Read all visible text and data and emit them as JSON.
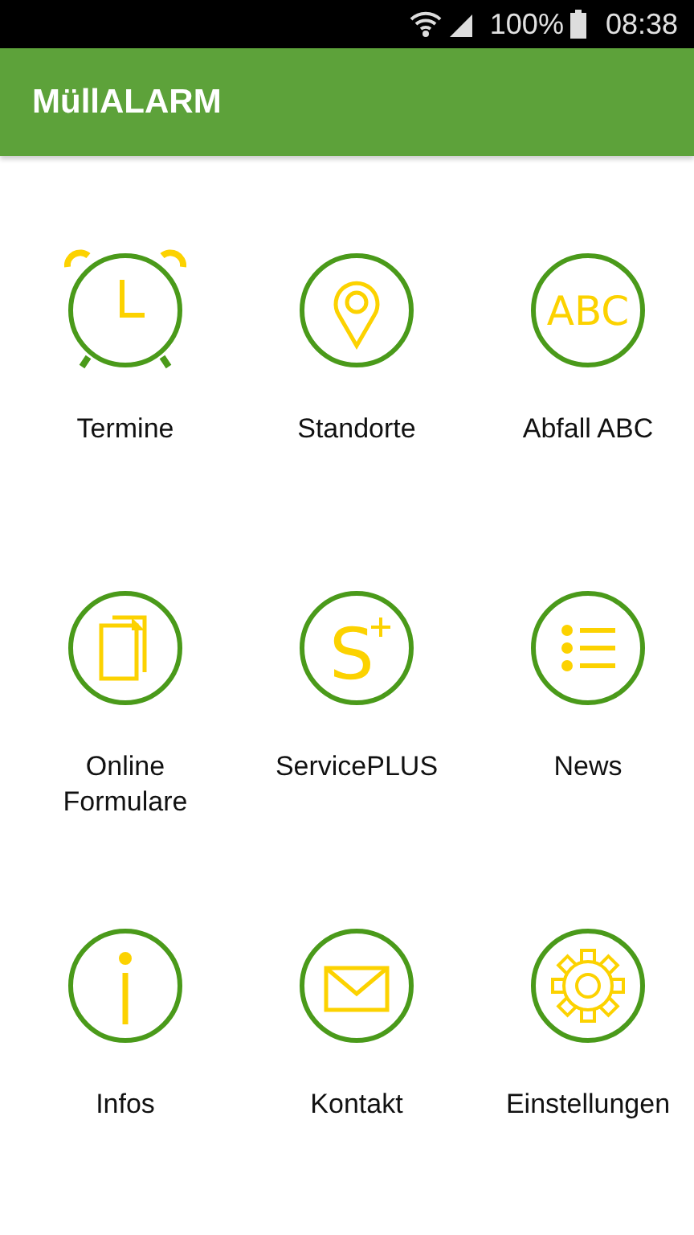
{
  "status_bar": {
    "battery": "100%",
    "time": "08:38"
  },
  "app_bar": {
    "title": "MüllALARM"
  },
  "tiles": [
    {
      "label": "Termine"
    },
    {
      "label": "Standorte"
    },
    {
      "label": "Abfall ABC",
      "icon_text": "ABC"
    },
    {
      "label": "Online Formulare"
    },
    {
      "label": "ServicePLUS",
      "icon_text": "S"
    },
    {
      "label": "News"
    },
    {
      "label": "Infos"
    },
    {
      "label": "Kontakt"
    },
    {
      "label": "Einstellungen"
    }
  ]
}
